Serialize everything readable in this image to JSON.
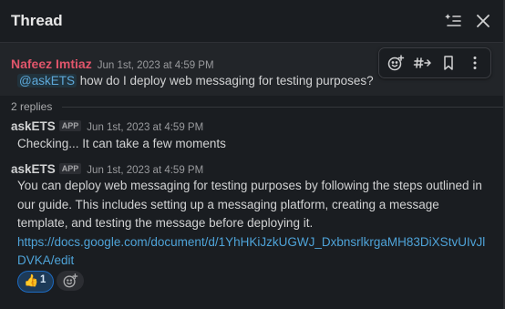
{
  "header": {
    "title": "Thread"
  },
  "parent_message": {
    "author": "Nafeez Imtiaz",
    "author_color": "#e0556b",
    "timestamp": "Jun 1st, 2023 at 4:59 PM",
    "mention": "@askETS",
    "text": " how do I deploy web messaging for testing purposes?"
  },
  "toolbar": {
    "icons": [
      "add-reaction-icon",
      "channel-forward-icon",
      "bookmark-icon",
      "more-actions-icon"
    ]
  },
  "replies_label": "2 replies",
  "replies": [
    {
      "author": "askETS",
      "badge": "APP",
      "timestamp": "Jun 1st, 2023 at 4:59 PM",
      "text": "Checking... It can take a few moments"
    },
    {
      "author": "askETS",
      "badge": "APP",
      "timestamp": "Jun 1st, 2023 at 4:59 PM",
      "text": "You can deploy web messaging for testing purposes by following the steps outlined in our guide. This includes setting up a messaging platform, creating a message template, and testing the message before deploying it.",
      "link": "https://docs.google.com/document/d/1YhHKiJzkUGWJ_DxbnsrlkrgaMH83DiXStvUIvJlDVKA/edit"
    }
  ],
  "reaction": {
    "emoji": "👍",
    "count": "1"
  },
  "colors": {
    "accent_link": "#4ea3d8",
    "reaction_bg": "#1d3a58",
    "reaction_border": "#1d6ac0"
  }
}
